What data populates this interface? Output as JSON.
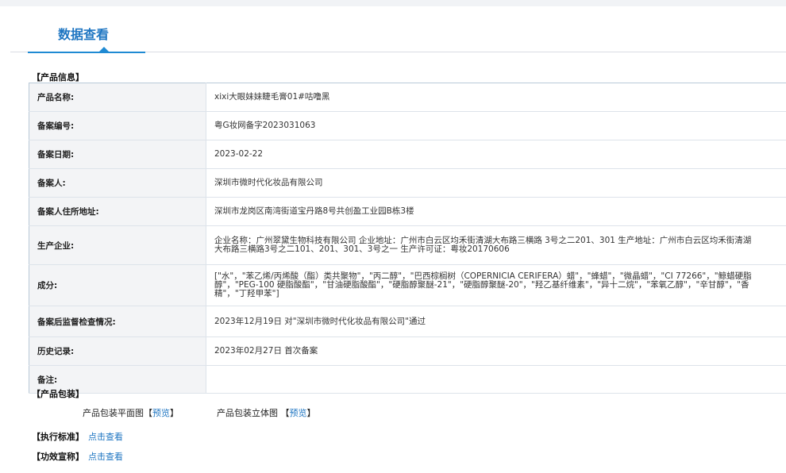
{
  "tab": {
    "label": "数据查看"
  },
  "product_info": {
    "section_title": "【产品信息】",
    "rows": [
      {
        "key": "产品名称:",
        "value": "xixi大眼妹妹睫毛膏01#咕噜黑"
      },
      {
        "key": "备案编号:",
        "value": "粤G妆网备字2023031063"
      },
      {
        "key": "备案日期:",
        "value": "2023-02-22"
      },
      {
        "key": "备案人:",
        "value": "深圳市微时代化妆品有限公司"
      },
      {
        "key": "备案人住所地址:",
        "value": "深圳市龙岗区南湾街道宝丹路8号共创盈工业园B栋3楼"
      },
      {
        "key": "生产企业:",
        "value": "企业名称：广州翠黛生物科技有限公司 企业地址：广州市白云区均禾街清湖大布路三横路 3号之二201、301 生产地址：广州市白云区均禾街清湖大布路三横路3号之二101、201、301、3号之一 生产许可证：粤妆20170606"
      },
      {
        "key": "成分:",
        "value": "[\"水\"，\"苯乙烯/丙烯酸（酯）类共聚物\"，\"丙二醇\"，\"巴西棕榈树（COPERNICIA CERIFERA）蜡\"，\"蜂蜡\"，\"微晶蜡\"，\"CI 77266\"，\"鲸蜡硬脂醇\"，\"PEG-100 硬脂酸酯\"，\"甘油硬脂酸酯\"，\"硬脂醇聚醚-21\"，\"硬脂醇聚醚-20\"，\"羟乙基纤维素\"，\"异十二烷\"，\"苯氧乙醇\"，\"辛甘醇\"，\"香精\"，\"丁羟甲苯\"]"
      },
      {
        "key": "备案后监督检查情况:",
        "value": "2023年12月19日 对\"深圳市微时代化妆品有限公司\"通过"
      },
      {
        "key": "历史记录:",
        "value": "2023年02月27日 首次备案"
      },
      {
        "key": "备注:",
        "value": ""
      }
    ]
  },
  "packaging": {
    "section_title": "【产品包装】",
    "flat_label": "产品包装平面图",
    "solid_label": "产品包装立体图",
    "bracket_open": "【",
    "bracket_close": "】",
    "preview_label": "预览"
  },
  "standard": {
    "label": "【执行标准】",
    "link": "点击查看"
  },
  "efficacy": {
    "label": "【功效宣称】",
    "link": "点击查看"
  },
  "colors": {
    "accent": "#1f8ad3",
    "link": "#1f76c2",
    "key_bg": "#f3f4f6"
  }
}
